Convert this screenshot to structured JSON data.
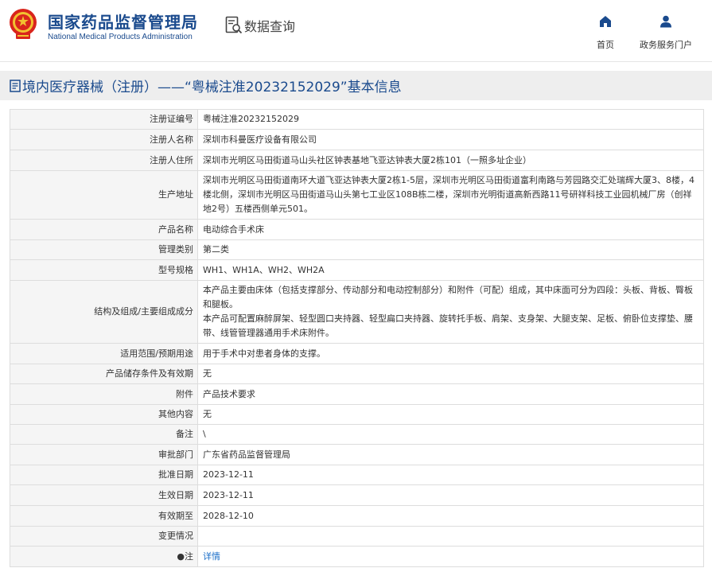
{
  "header": {
    "org_cn": "国家药品监督管理局",
    "org_en": "National Medical Products Administration",
    "query_label": "数据查询",
    "nav": [
      {
        "label": "首页",
        "icon": "home-icon"
      },
      {
        "label": "政务服务门户",
        "icon": "user-icon"
      }
    ]
  },
  "title": "境内医疗器械（注册）——“粤械注准20232152029”基本信息",
  "rows": [
    {
      "label": "注册证编号",
      "value": "粤械注准20232152029"
    },
    {
      "label": "注册人名称",
      "value": "深圳市科曼医疗设备有限公司"
    },
    {
      "label": "注册人住所",
      "value": "深圳市光明区马田街道马山头社区钟表基地飞亚达钟表大厦2栋101（一照多址企业）"
    },
    {
      "label": "生产地址",
      "value": "深圳市光明区马田街道南环大道飞亚达钟表大厦2栋1-5层，深圳市光明区马田街道富利南路与芳园路交汇处瑞辉大厦3、8楼，4楼北侧，深圳市光明区马田街道马山头第七工业区108B栋二楼，深圳市光明街道高新西路11号研祥科技工业园机械厂房（创祥地2号）五楼西侧单元501。"
    },
    {
      "label": "产品名称",
      "value": "电动综合手术床"
    },
    {
      "label": "管理类别",
      "value": "第二类"
    },
    {
      "label": "型号规格",
      "value": "WH1、WH1A、WH2、WH2A"
    },
    {
      "label": "结构及组成/主要组成成分",
      "value": "本产品主要由床体（包括支撑部分、传动部分和电动控制部分）和附件（可配）组成，其中床面可分为四段：头板、背板、臀板和腿板。",
      "value2": "本产品可配置麻醉屏架、轻型圆口夹持器、轻型扁口夹持器、旋转托手板、肩架、支身架、大腿支架、足板、俯卧位支撑垫、腰带、线管管理器通用手术床附件。"
    },
    {
      "label": "适用范围/预期用途",
      "value": "用于手术中对患者身体的支撑。"
    },
    {
      "label": "产品储存条件及有效期",
      "value": "无"
    },
    {
      "label": "附件",
      "value": "产品技术要求"
    },
    {
      "label": "其他内容",
      "value": "无"
    },
    {
      "label": "备注",
      "value": "\\"
    },
    {
      "label": "审批部门",
      "value": "广东省药品监督管理局"
    },
    {
      "label": "批准日期",
      "value": "2023-12-11"
    },
    {
      "label": "生效日期",
      "value": "2023-12-11"
    },
    {
      "label": "有效期至",
      "value": "2028-12-10"
    },
    {
      "label": "变更情况",
      "value": ""
    },
    {
      "label": "注",
      "label_prefix": "●",
      "value": "详情"
    }
  ]
}
